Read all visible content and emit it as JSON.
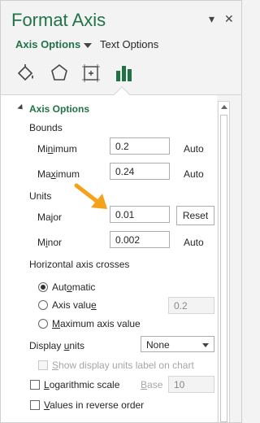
{
  "header": {
    "title": "Format Axis",
    "dropdown_glyph": "▾",
    "close_glyph": "✕"
  },
  "tabs": {
    "axis_options": "Axis Options",
    "text_options": "Text Options"
  },
  "icons": [
    "fill-line-icon",
    "effects-icon",
    "size-properties-icon",
    "axis-options-icon"
  ],
  "section": {
    "title": "Axis Options"
  },
  "bounds": {
    "label": "Bounds",
    "minimum": {
      "pre": "Mi",
      "acc": "n",
      "post": "imum",
      "value": "0.2",
      "mode": "Auto"
    },
    "maximum": {
      "pre": "Ma",
      "acc": "x",
      "post": "imum",
      "value": "0.24",
      "mode": "Auto"
    }
  },
  "units": {
    "label": "Units",
    "major": {
      "pre": "Ma",
      "acc": "j",
      "post": "or",
      "value": "0.01",
      "button": "Reset"
    },
    "minor": {
      "pre": "M",
      "acc": "i",
      "post": "nor",
      "value": "0.002",
      "mode": "Auto"
    }
  },
  "crosses": {
    "label": "Horizontal axis crosses",
    "automatic": {
      "pre": "Aut",
      "acc": "o",
      "post": "matic"
    },
    "axis_value": {
      "pre": "Axis valu",
      "acc": "e",
      "post": "",
      "value": "0.2"
    },
    "max_value": {
      "pre": "",
      "acc": "M",
      "post": "aximum axis value"
    }
  },
  "display_units": {
    "pre": "Display ",
    "acc": "u",
    "post": "nits",
    "selected": "None",
    "show_label": {
      "pre": "",
      "acc": "S",
      "post": "how display units label on chart"
    }
  },
  "log_scale": {
    "pre": "",
    "acc": "L",
    "post": "ogarithmic scale",
    "base_pre": "",
    "base_acc": "B",
    "base_post": "ase",
    "base_value": "10"
  },
  "reverse": {
    "pre": "",
    "acc": "V",
    "post": "alues in reverse order"
  },
  "colors": {
    "accent": "#217346",
    "annotation_arrow": "#f5a21b"
  }
}
